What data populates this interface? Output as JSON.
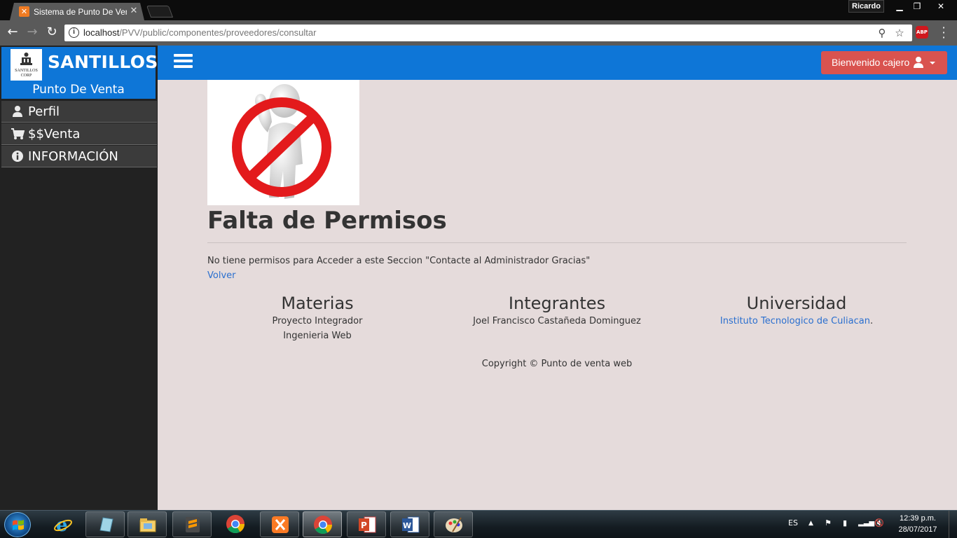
{
  "browser": {
    "tab_title": "Sistema de Punto De Venta",
    "tab_favicon": "xampp-icon",
    "profile_name": "Ricardo",
    "url_host": "localhost",
    "url_path": "/PVV/public/componentes/proveedores/consultar",
    "abp_label": "ABP"
  },
  "sidebar": {
    "brand_name": "SANTILLOS",
    "brand_sub": "Punto De Venta",
    "logo_text": "SANTILLOS",
    "logo_subtext": "CORP",
    "items": [
      {
        "label": "Perfil",
        "icon": "user-icon"
      },
      {
        "label": "$$Venta",
        "icon": "cart-icon"
      },
      {
        "label": "INFORMACIÓN",
        "icon": "info-icon"
      }
    ]
  },
  "navbar": {
    "user_button_label": "Bienvenido cajero"
  },
  "content": {
    "title": "Falta de Permisos",
    "message": "No tiene permisos para Acceder a este Seccion \"Contacte al Administrador Gracias\"",
    "back_link": "Volver"
  },
  "footer": {
    "materias_title": "Materias",
    "materias": [
      "Proyecto Integrador",
      "Ingenieria Web"
    ],
    "integrantes_title": "Integrantes",
    "integrantes": [
      "Joel Francisco Castañeda Dominguez"
    ],
    "universidad_title": "Universidad",
    "universidad_link": "Instituto Tecnologico de Culiacan",
    "universidad_suffix": ".",
    "copyright": "Copyright © Punto de venta web"
  },
  "taskbar": {
    "apps": [
      "ie-icon",
      "app-icon",
      "explorer-icon",
      "sublime-icon",
      "chrome-icon",
      "xampp-icon",
      "chrome-icon",
      "powerpoint-icon",
      "word-icon",
      "paint-icon"
    ],
    "language": "ES",
    "time": "12:39 p.m.",
    "date": "28/07/2017"
  }
}
